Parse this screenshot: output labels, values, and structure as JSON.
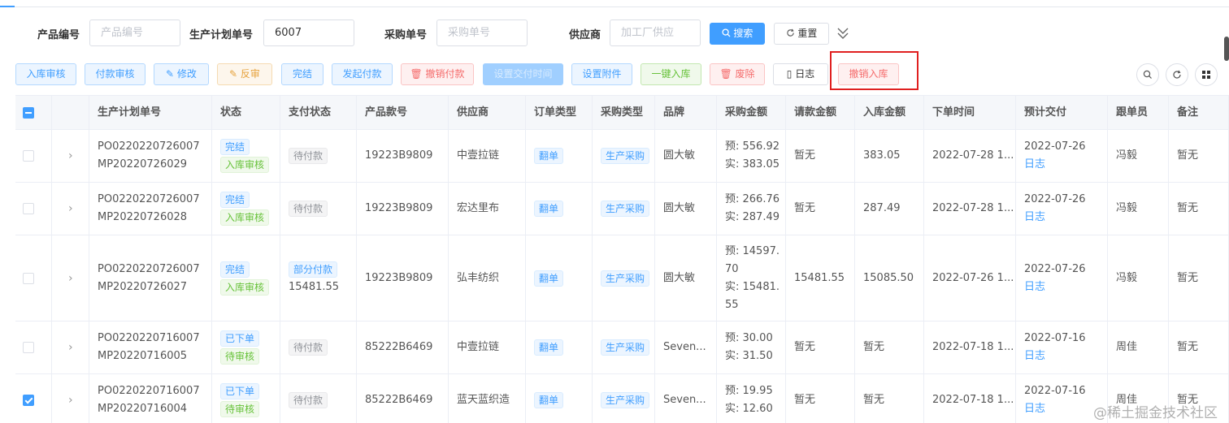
{
  "search": {
    "product_code_label": "产品编号",
    "product_code_placeholder": "产品编号",
    "plan_no_label": "生产计划单号",
    "plan_no_value": "6007",
    "purchase_no_label": "采购单号",
    "purchase_no_placeholder": "采购单号",
    "supplier_label": "供应商",
    "supplier_placeholder": "加工厂供应",
    "search_button": "搜索",
    "reset_button": "重置"
  },
  "toolbar": {
    "buttons": [
      {
        "label": "入库审核"
      },
      {
        "label": "付款审核"
      },
      {
        "label": "修改"
      },
      {
        "label": "反审"
      },
      {
        "label": "完结"
      },
      {
        "label": "发起付款"
      },
      {
        "label": "撤销付款"
      },
      {
        "label": "设置交付时间"
      },
      {
        "label": "设置附件"
      },
      {
        "label": "一键入库"
      },
      {
        "label": "废除"
      },
      {
        "label": "日志"
      },
      {
        "label": "撤销入库"
      }
    ]
  },
  "table": {
    "columns": [
      "生产计划单号",
      "状态",
      "支付状态",
      "产品款号",
      "供应商",
      "订单类型",
      "采购类型",
      "品牌",
      "采购金额",
      "请款金额",
      "入库金额",
      "下单时间",
      "预计交付",
      "跟单员",
      "备注"
    ],
    "rows": [
      {
        "checked": false,
        "plan_no": "PO0220220726007",
        "po_no": "MP20220726029",
        "status1": "完结",
        "status2": "入库审核",
        "pay_status": "待付款",
        "pay_amount": "",
        "style_no": "19223B9809",
        "supplier": "中壹拉链",
        "order_type": "翻单",
        "purchase_type": "生产采购",
        "brand": "圆大敏",
        "amount_pre": "预: 556.92",
        "amount_act": "实: 383.05",
        "amount_pre2": "",
        "amount_act2": "",
        "request": "暂无",
        "inbound": "383.05",
        "order_time": "2022-07-28 1...",
        "delivery": "2022-07-26",
        "delivery_log": "日志",
        "merchandiser": "冯毅",
        "remark": "暂无"
      },
      {
        "checked": false,
        "plan_no": "PO0220220726007",
        "po_no": "MP20220726028",
        "status1": "完结",
        "status2": "入库审核",
        "pay_status": "待付款",
        "pay_amount": "",
        "style_no": "19223B9809",
        "supplier": "宏达里布",
        "order_type": "翻单",
        "purchase_type": "生产采购",
        "brand": "圆大敏",
        "amount_pre": "预: 266.76",
        "amount_act": "实: 287.49",
        "amount_pre2": "",
        "amount_act2": "",
        "request": "暂无",
        "inbound": "287.49",
        "order_time": "2022-07-28 1...",
        "delivery": "2022-07-26",
        "delivery_log": "日志",
        "merchandiser": "冯毅",
        "remark": "暂无"
      },
      {
        "checked": false,
        "plan_no": "PO0220220726007",
        "po_no": "MP20220726027",
        "status1": "完结",
        "status2": "入库审核",
        "pay_status": "部分付款",
        "pay_amount": "15481.55",
        "style_no": "19223B9809",
        "supplier": "弘丰纺织",
        "order_type": "翻单",
        "purchase_type": "生产采购",
        "brand": "圆大敏",
        "amount_pre": "预: 14597.",
        "amount_act": "70",
        "amount_pre2": "实: 15481.",
        "amount_act2": "55",
        "request": "15481.55",
        "inbound": "15085.50",
        "order_time": "2022-07-26 1...",
        "delivery": "2022-07-26",
        "delivery_log": "日志",
        "merchandiser": "冯毅",
        "remark": "暂无"
      },
      {
        "checked": false,
        "plan_no": "PO0220220716007",
        "po_no": "MP20220716005",
        "status1": "已下单",
        "status2": "待审核",
        "pay_status": "待付款",
        "pay_amount": "",
        "style_no": "85222B6469",
        "supplier": "中壹拉链",
        "order_type": "翻单",
        "purchase_type": "生产采购",
        "brand": "Seven...",
        "amount_pre": "预: 30.00",
        "amount_act": "实: 31.50",
        "amount_pre2": "",
        "amount_act2": "",
        "request": "暂无",
        "inbound": "暂无",
        "order_time": "2022-07-18 1...",
        "delivery": "2022-07-16",
        "delivery_log": "日志",
        "merchandiser": "周佳",
        "remark": "暂无"
      },
      {
        "checked": true,
        "plan_no": "PO0220220716007",
        "po_no": "MP20220716004",
        "status1": "已下单",
        "status2": "待审核",
        "pay_status": "待付款",
        "pay_amount": "",
        "style_no": "85222B6469",
        "supplier": "蓝天蓝织造",
        "order_type": "翻单",
        "purchase_type": "生产采购",
        "brand": "Seven...",
        "amount_pre": "预: 19.95",
        "amount_act": "实: 12.60",
        "amount_pre2": "",
        "amount_act2": "",
        "request": "暂无",
        "inbound": "暂无",
        "order_time": "2022-07-18 1...",
        "delivery": "2022-07-16",
        "delivery_log": "日志",
        "merchandiser": "周佳",
        "remark": "暂无"
      }
    ]
  },
  "watermark": "@稀土掘金技术社区"
}
